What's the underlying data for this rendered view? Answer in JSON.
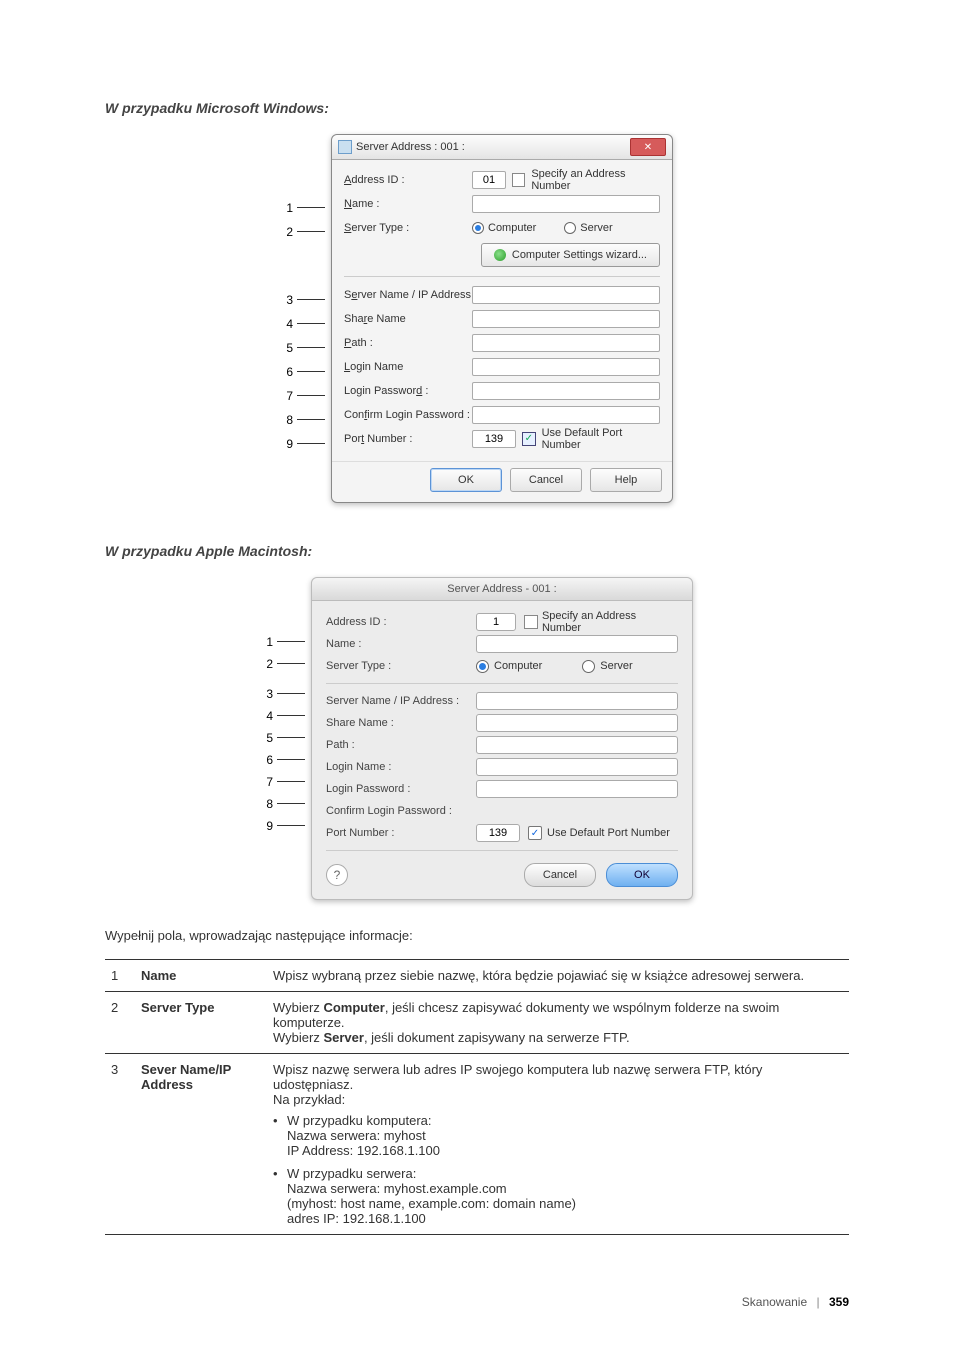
{
  "headings": {
    "win": "W przypadku Microsoft Windows:",
    "mac": "W przypadku Apple Macintosh:"
  },
  "win": {
    "title": "Server Address : 001 :",
    "address_id_lbl": "Address ID :",
    "address_id_val": "01",
    "specify_lbl": "Specify an Address Number",
    "name_lbl": "Name :",
    "server_type_lbl": "Server Type :",
    "radio_computer": "Computer",
    "radio_server": "Server",
    "wizard_btn": "Computer Settings wizard...",
    "server_name_lbl": "Server Name / IP Address :",
    "share_name_lbl": "Share Name",
    "path_lbl": "Path :",
    "login_name_lbl": "Login Name",
    "login_pw_lbl": "Login Password :",
    "confirm_pw_lbl": "Confirm Login Password :",
    "port_lbl": "Port Number :",
    "port_val": "139",
    "use_default_port": "Use Default Port Number",
    "ok": "OK",
    "cancel": "Cancel",
    "help": "Help"
  },
  "mac": {
    "title": "Server Address - 001 :",
    "address_id_lbl": "Address ID :",
    "address_id_val": "1",
    "specify_lbl": "Specify an Address Number",
    "name_lbl": "Name :",
    "server_type_lbl": "Server Type :",
    "radio_computer": "Computer",
    "radio_server": "Server",
    "server_name_lbl": "Server Name / IP Address :",
    "share_name_lbl": "Share Name :",
    "path_lbl": "Path :",
    "login_name_lbl": "Login Name :",
    "login_pw_lbl": "Login Password :",
    "confirm_pw_lbl": "Confirm Login Password :",
    "port_lbl": "Port Number :",
    "port_val": "139",
    "use_default_port": "Use Default Port Number",
    "cancel": "Cancel",
    "ok": "OK",
    "help": "?"
  },
  "intro": "Wypełnij pola, wprowadzając następujące informacje:",
  "table": {
    "r1": {
      "n": "1",
      "t": "Name",
      "d": "Wpisz wybraną przez siebie nazwę, która będzie pojawiać się w książce adresowej serwera."
    },
    "r2": {
      "n": "2",
      "t": "Server Type",
      "d1": "Wybierz ",
      "d1b": "Computer",
      "d1c": ", jeśli chcesz zapisywać dokumenty we wspólnym folderze na swoim komputerze.",
      "d2": "Wybierz ",
      "d2b": "Server",
      "d2c": ", jeśli dokument zapisywany na serwerze FTP."
    },
    "r3": {
      "n": "3",
      "t": "Sever Name/IP Address",
      "d1": "Wpisz nazwę serwera lub adres IP swojego komputera lub nazwę serwera FTP, który udostępniasz.",
      "d2": "Na przykład:",
      "c_head": "W przypadku komputera:",
      "c_l1": "Nazwa serwera: myhost",
      "c_l2": "IP Address: 192.168.1.100",
      "s_head": "W przypadku serwera:",
      "s_l1": "Nazwa serwera: myhost.example.com",
      "s_l2": "(myhost: host name, example.com: domain name)",
      "s_l3": "adres IP: 192.168.1.100"
    }
  },
  "footer": {
    "label": "Skanowanie",
    "page": "359"
  }
}
